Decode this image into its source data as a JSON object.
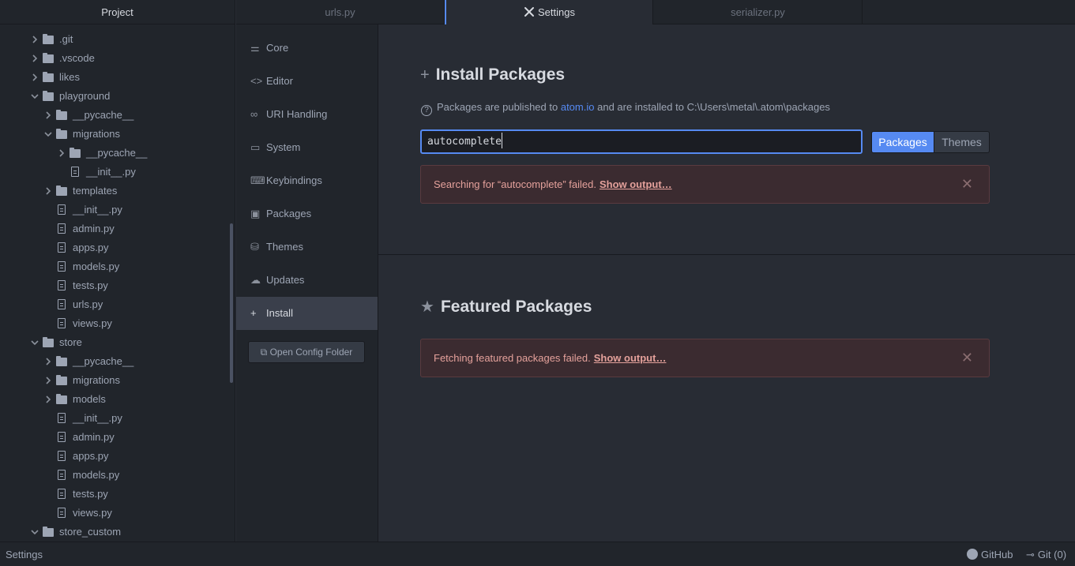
{
  "tree": {
    "title": "Project",
    "rows": [
      {
        "label": ".git",
        "type": "folder",
        "depth": 0,
        "expanded": false
      },
      {
        "label": ".vscode",
        "type": "folder",
        "depth": 0,
        "expanded": false
      },
      {
        "label": "likes",
        "type": "folder",
        "depth": 0,
        "expanded": false
      },
      {
        "label": "playground",
        "type": "folder",
        "depth": 0,
        "expanded": true
      },
      {
        "label": "__pycache__",
        "type": "folder",
        "depth": 1,
        "expanded": false
      },
      {
        "label": "migrations",
        "type": "folder",
        "depth": 1,
        "expanded": true
      },
      {
        "label": "__pycache__",
        "type": "folder",
        "depth": 2,
        "expanded": false
      },
      {
        "label": "__init__.py",
        "type": "file",
        "depth": 2
      },
      {
        "label": "templates",
        "type": "folder",
        "depth": 1,
        "expanded": false
      },
      {
        "label": "__init__.py",
        "type": "file",
        "depth": 1
      },
      {
        "label": "admin.py",
        "type": "file",
        "depth": 1
      },
      {
        "label": "apps.py",
        "type": "file",
        "depth": 1
      },
      {
        "label": "models.py",
        "type": "file",
        "depth": 1
      },
      {
        "label": "tests.py",
        "type": "file",
        "depth": 1
      },
      {
        "label": "urls.py",
        "type": "file",
        "depth": 1
      },
      {
        "label": "views.py",
        "type": "file",
        "depth": 1
      },
      {
        "label": "store",
        "type": "folder",
        "depth": 0,
        "expanded": true
      },
      {
        "label": "__pycache__",
        "type": "folder",
        "depth": 1,
        "expanded": false
      },
      {
        "label": "migrations",
        "type": "folder",
        "depth": 1,
        "expanded": false
      },
      {
        "label": "models",
        "type": "folder",
        "depth": 1,
        "expanded": false
      },
      {
        "label": "__init__.py",
        "type": "file",
        "depth": 1
      },
      {
        "label": "admin.py",
        "type": "file",
        "depth": 1
      },
      {
        "label": "apps.py",
        "type": "file",
        "depth": 1
      },
      {
        "label": "models.py",
        "type": "file",
        "depth": 1
      },
      {
        "label": "tests.py",
        "type": "file",
        "depth": 1
      },
      {
        "label": "views.py",
        "type": "file",
        "depth": 1
      },
      {
        "label": "store_custom",
        "type": "folder",
        "depth": 0,
        "expanded": true
      }
    ]
  },
  "tabs": [
    {
      "label": "urls.py",
      "active": false
    },
    {
      "label": "Settings",
      "active": true,
      "icon": "wrench-screwdriver-icon"
    },
    {
      "label": "serializer.py",
      "active": false
    }
  ],
  "settings_nav": {
    "items": [
      {
        "label": "Core",
        "icon": "sliders-icon",
        "glyph": "⚌"
      },
      {
        "label": "Editor",
        "icon": "code-icon",
        "glyph": "<>"
      },
      {
        "label": "URI Handling",
        "icon": "link-icon",
        "glyph": "∞"
      },
      {
        "label": "System",
        "icon": "monitor-icon",
        "glyph": "▭"
      },
      {
        "label": "Keybindings",
        "icon": "keyboard-icon",
        "glyph": "⌨"
      },
      {
        "label": "Packages",
        "icon": "package-icon",
        "glyph": "▣"
      },
      {
        "label": "Themes",
        "icon": "paintcan-icon",
        "glyph": "⛁"
      },
      {
        "label": "Updates",
        "icon": "cloud-download-icon",
        "glyph": "☁"
      },
      {
        "label": "Install",
        "icon": "plus-icon",
        "glyph": "+",
        "active": true
      }
    ],
    "open_config_label": "Open Config Folder"
  },
  "install": {
    "title": "Install Packages",
    "info_prefix": "Packages are published to",
    "info_link": "atom.io",
    "info_suffix": "and are installed to C:\\Users\\metal\\.atom\\packages",
    "search_value": "autocomplete",
    "packages_button": "Packages",
    "themes_button": "Themes",
    "error_text": "Searching for “autocomplete” failed.",
    "error_link": "Show output…"
  },
  "featured": {
    "title": "Featured Packages",
    "error_text": "Fetching featured packages failed.",
    "error_link": "Show output…"
  },
  "statusbar": {
    "left": "Settings",
    "github": "GitHub",
    "git": "Git (0)"
  },
  "colors": {
    "accent": "#568af2",
    "error_bg": "#3b2b30",
    "error_text": "#e4a19b"
  }
}
